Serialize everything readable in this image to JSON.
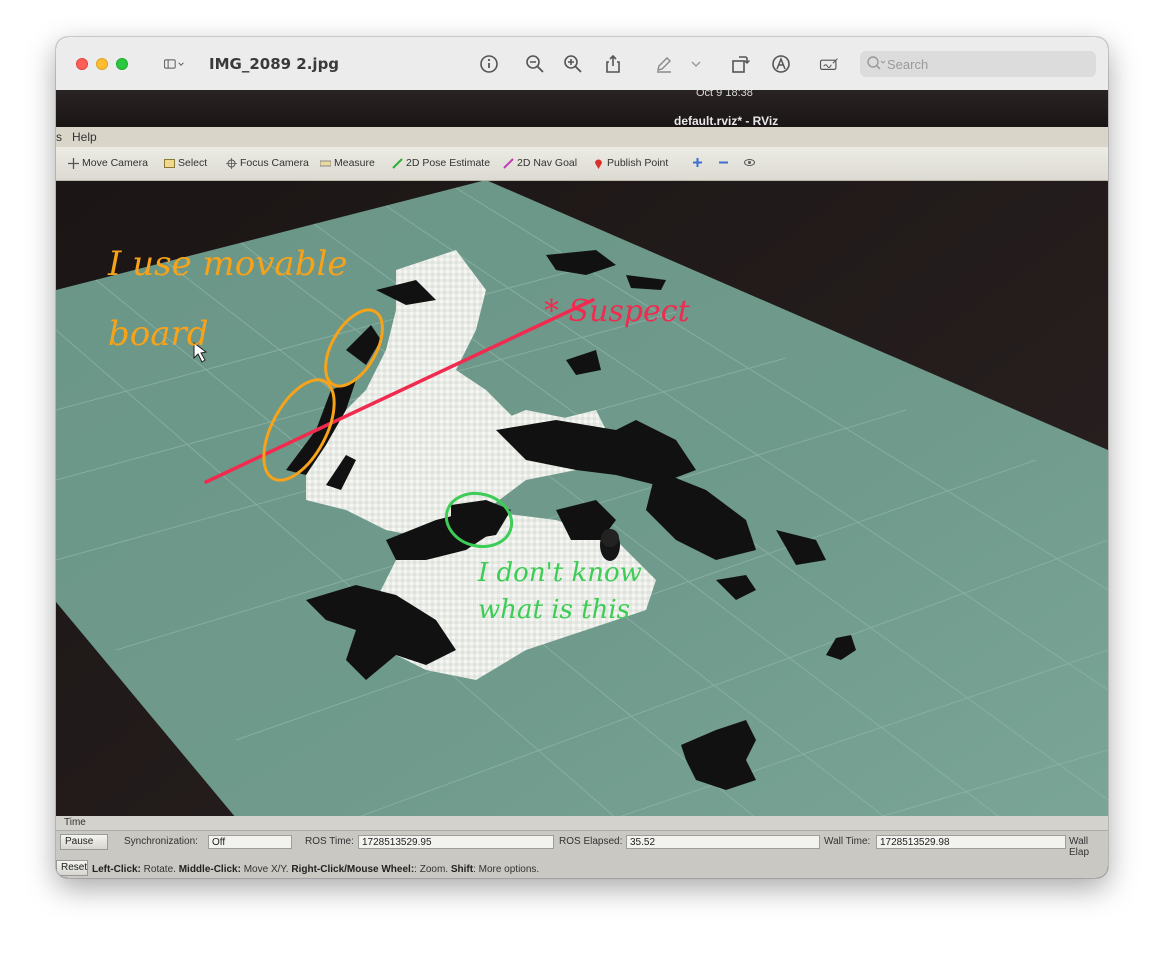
{
  "viewer": {
    "file_name": "IMG_2089 2.jpg",
    "search_placeholder": "Search"
  },
  "rviz": {
    "clock": "Oct 9  18:38",
    "window_title": "default.rviz* - RViz",
    "menu": [
      "s",
      "Help"
    ],
    "tools": [
      {
        "label": "Move Camera",
        "icon": "move-camera-icon"
      },
      {
        "label": "Select",
        "icon": "select-icon"
      },
      {
        "label": "Focus Camera",
        "icon": "focus-camera-icon"
      },
      {
        "label": "Measure",
        "icon": "measure-icon"
      },
      {
        "label": "2D Pose Estimate",
        "icon": "pose-estimate-icon"
      },
      {
        "label": "2D Nav Goal",
        "icon": "nav-goal-icon"
      },
      {
        "label": "Publish Point",
        "icon": "publish-point-icon"
      }
    ],
    "time_panel": {
      "title": "Time",
      "pause_label": "Pause",
      "sync_label": "Synchronization:",
      "sync_value": "Off",
      "ros_time_label": "ROS Time:",
      "ros_time_value": "1728513529.95",
      "ros_elapsed_label": "ROS Elapsed:",
      "ros_elapsed_value": "35.52",
      "wall_time_label": "Wall Time:",
      "wall_time_value": "1728513529.98",
      "wall_elapsed_label": "Wall Elap"
    },
    "status": {
      "reset_label": "Reset",
      "k1": "Left-Click:",
      "v1": " Rotate. ",
      "k2": "Middle-Click:",
      "v2": " Move X/Y. ",
      "k3": "Right-Click/Mouse Wheel:",
      "v3": ": Zoom. ",
      "k4": "Shift",
      "v4": ": More options."
    }
  },
  "annotations": {
    "orange_line1": "I use movable",
    "orange_line2": "board",
    "red": "* Suspect",
    "green_line1": "I don't know",
    "green_line2": "what is this"
  },
  "colors": {
    "grid_floor": "#6f9a8c",
    "annotation_orange": "#f7a31a",
    "annotation_red": "#f02b4f",
    "annotation_green": "#3dcc55"
  }
}
